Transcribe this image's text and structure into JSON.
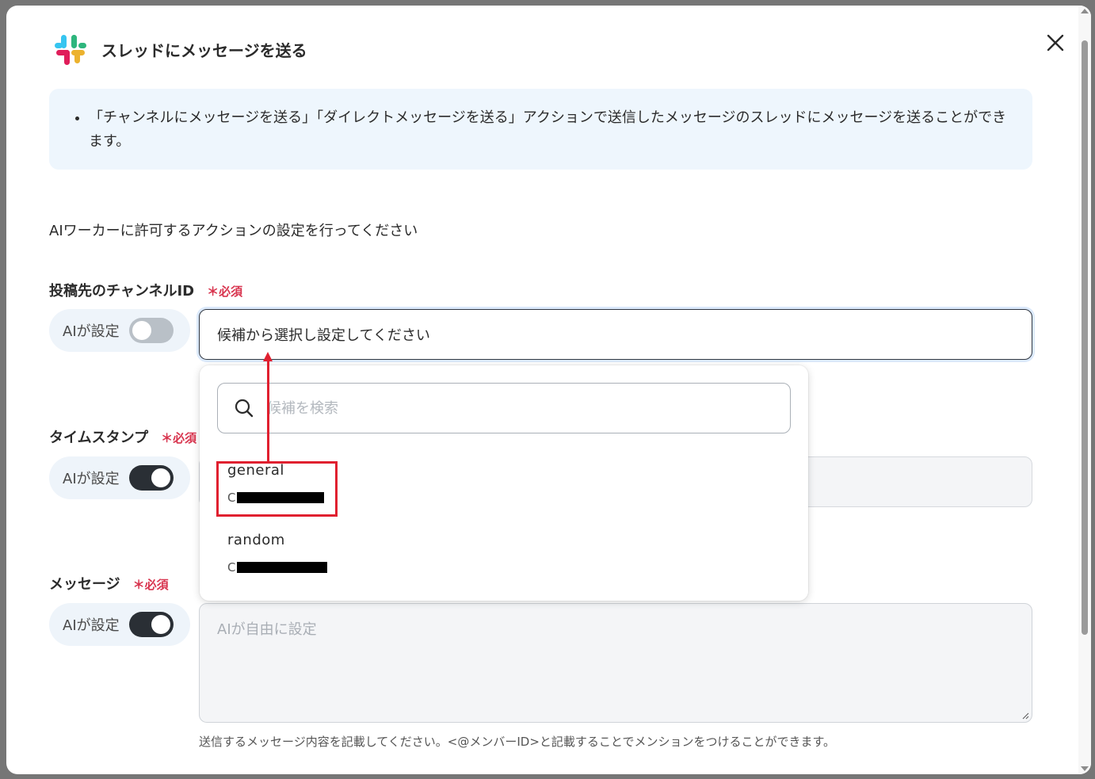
{
  "modal": {
    "title": "スレッドにメッセージを送る",
    "info": "「チャンネルにメッセージを送る」「ダイレクトメッセージを送る」アクションで送信したメッセージのスレッドにメッセージを送ることができます。",
    "intro": "AIワーカーに許可するアクションの設定を行ってください"
  },
  "fields": {
    "channel": {
      "label": "投稿先のチャンネルID",
      "required": "＊必須",
      "ai_toggle_label": "AIが設定",
      "ai_toggle_on": false,
      "select_value": "候補から選択し設定してください"
    },
    "timestamp": {
      "label": "タイムスタンプ",
      "required": "＊必須",
      "ai_toggle_label": "AIが設定",
      "ai_toggle_on": true
    },
    "message": {
      "label": "メッセージ",
      "required": "＊必須",
      "ai_toggle_label": "AIが設定",
      "ai_toggle_on": true,
      "placeholder": "AIが自由に設定",
      "help": "送信するメッセージ内容を記載してください。<@メンバーID>と記載することでメンションをつけることができます。"
    }
  },
  "dropdown": {
    "search_placeholder": "候補を検索",
    "options": [
      {
        "name": "general",
        "id_prefix": "C",
        "redacted": true
      },
      {
        "name": "random",
        "id_prefix": "C",
        "redacted": true
      }
    ]
  },
  "icons": {
    "close": "close-icon",
    "search": "search-icon",
    "logo": "slack-logo-icon"
  },
  "colors": {
    "required": "#d8344e",
    "annotation": "#e0202f",
    "info_bg": "#eef6fd",
    "toggle_on": "#2a2f35",
    "toggle_off": "#b9c0c7"
  }
}
